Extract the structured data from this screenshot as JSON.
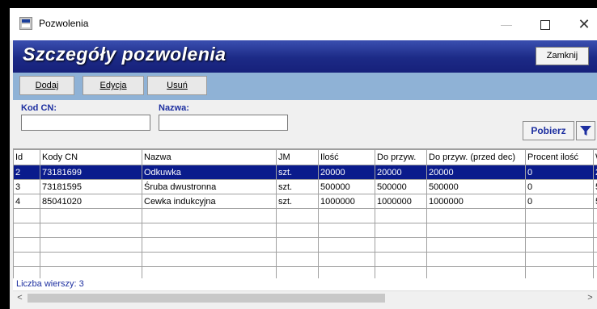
{
  "window": {
    "title": "Pozwolenia",
    "minimize_glyph": "—",
    "close_glyph": "✕"
  },
  "banner": {
    "title": "Szczegóły pozwolenia",
    "close_label": "Zamknij"
  },
  "toolbar": {
    "add_label": "Dodaj",
    "edit_label": "Edycja",
    "delete_label": "Usuń"
  },
  "filters": {
    "cn_label": "Kod CN:",
    "cn_value": "",
    "name_label": "Nazwa:",
    "name_value": "",
    "fetch_label": "Pobierz",
    "filter_icon": "funnel-icon"
  },
  "table": {
    "columns": [
      "Id",
      "Kody CN",
      "Nazwa",
      "JM",
      "Ilość",
      "Do przyw.",
      "Do przyw. (przed dec)",
      "Procent ilość",
      "W"
    ],
    "rows": [
      [
        "2",
        "73181699",
        "Odkuwka",
        "szt.",
        "20000",
        "20000",
        "20000",
        "0",
        "2"
      ],
      [
        "3",
        "73181595",
        "Śruba dwustronna",
        "szt.",
        "500000",
        "500000",
        "500000",
        "0",
        "5"
      ],
      [
        "4",
        "85041020",
        "Cewka indukcyjna",
        "szt.",
        "1000000",
        "1000000",
        "1000000",
        "0",
        "5"
      ]
    ],
    "selected_row": 0
  },
  "footer": {
    "row_count": "Liczba wierszy: 3"
  },
  "scrollbar": {
    "left_arrow": "<",
    "right_arrow": ">"
  },
  "colors": {
    "banner": "#1c2a86",
    "toolbar": "#8fb2d6",
    "selection": "#0a1b8c",
    "label": "#1d2fa0"
  }
}
